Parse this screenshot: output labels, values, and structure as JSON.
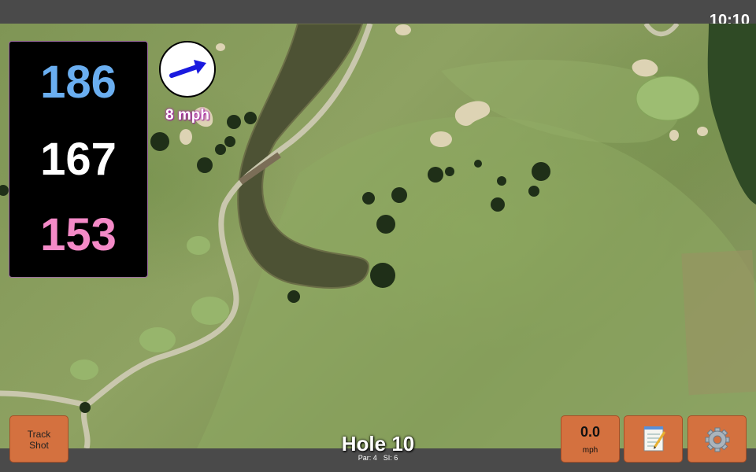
{
  "status": {
    "time": "10:10"
  },
  "distances": {
    "back": "186",
    "middle": "167",
    "front": "153"
  },
  "wind": {
    "speed": "8 mph",
    "icon": "wind-arrow-icon",
    "arrow_color": "#1a1adf"
  },
  "buttons": {
    "track_shot": "Track\nShot",
    "speed_value": "0.0",
    "speed_unit": "mph",
    "notes_icon": "notepad-icon",
    "settings_icon": "gear-icon"
  },
  "hole": {
    "title": "Hole 10",
    "par": "Par: 4",
    "si": "SI: 6"
  },
  "colors": {
    "back_distance": "#6aaef0",
    "middle_distance": "#ffffff",
    "front_distance": "#f48ac7",
    "button": "#d4713f",
    "wind_text_glow": "#b02ab0"
  }
}
